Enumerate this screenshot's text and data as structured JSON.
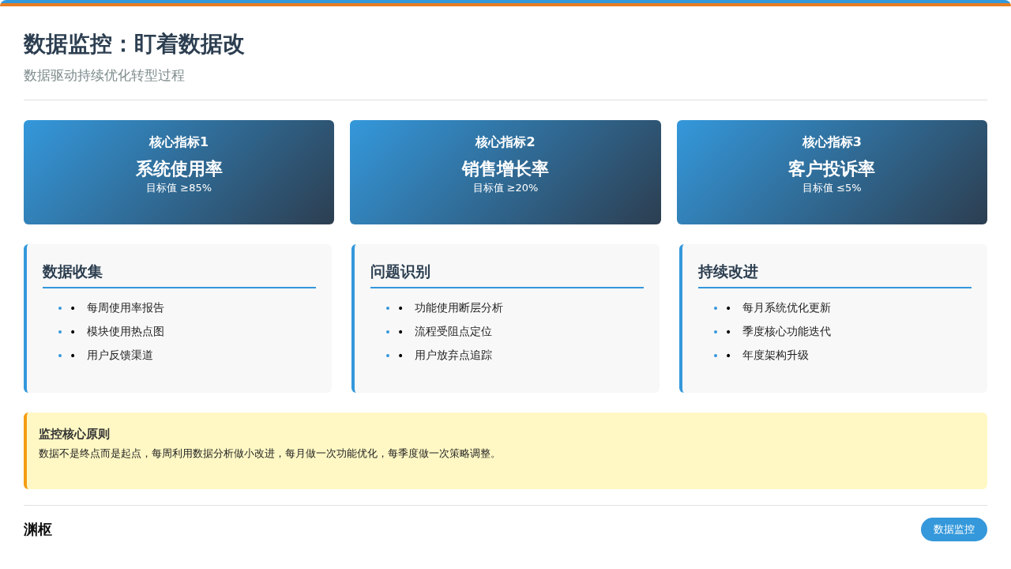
{
  "header": {
    "title": "数据监控：盯着数据改",
    "subtitle": "数据驱动持续优化转型过程"
  },
  "metrics": [
    {
      "label": "核心指标1",
      "name": "系统使用率",
      "target": "目标值 ≥85%"
    },
    {
      "label": "核心指标2",
      "name": "销售增长率",
      "target": "目标值 ≥20%"
    },
    {
      "label": "核心指标3",
      "name": "客户投诉率",
      "target": "目标值 ≤5%"
    }
  ],
  "sections": [
    {
      "title": "数据收集",
      "items": [
        {
          "bullet": "•",
          "text": "每周使用率报告"
        },
        {
          "bullet": "•",
          "text": "模块使用热点图"
        },
        {
          "bullet": "•",
          "text": "用户反馈渠道"
        }
      ]
    },
    {
      "title": "问题识别",
      "items": [
        {
          "bullet": "•",
          "text": "功能使用断层分析"
        },
        {
          "bullet": "•",
          "text": "流程受阻点定位"
        },
        {
          "bullet": "•",
          "text": "用户放弃点追踪"
        }
      ]
    },
    {
      "title": "持续改进",
      "items": [
        {
          "bullet": "•",
          "text": "每月系统优化更新"
        },
        {
          "bullet": "•",
          "text": "季度核心功能迭代"
        },
        {
          "bullet": "•",
          "text": "年度架构升级"
        }
      ]
    }
  ],
  "principle": {
    "title": "监控核心原则",
    "text": "数据不是终点而是起点，每周利用数据分析做小改进，每月做一次功能优化，每季度做一次策略调整。"
  },
  "footer": {
    "brand": "渊枢",
    "tag": "数据监控"
  }
}
